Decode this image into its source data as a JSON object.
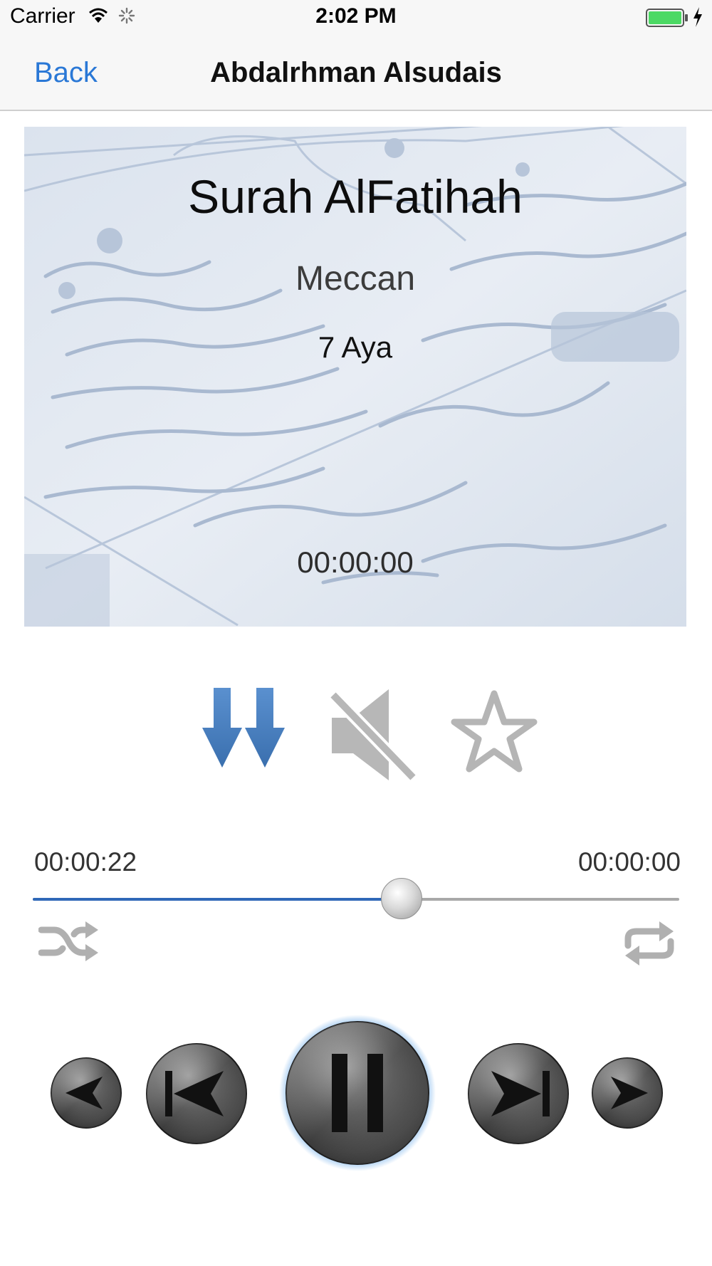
{
  "status_bar": {
    "carrier": "Carrier",
    "time": "2:02 PM"
  },
  "nav": {
    "back_label": "Back",
    "title": "Abdalrhman Alsudais"
  },
  "artwork": {
    "surah": "Surah AlFatihah",
    "type": "Meccan",
    "ayat": "7 Aya",
    "duration": "00:00:00"
  },
  "actions": {
    "download_icon": "double-down-arrow-icon",
    "mute_icon": "speaker-muted-icon",
    "favorite_icon": "star-outline-icon"
  },
  "progress": {
    "elapsed": "00:00:22",
    "remaining": "00:00:00",
    "position_fraction": 0.57
  },
  "modes": {
    "shuffle_icon": "shuffle-icon",
    "repeat_icon": "repeat-icon"
  },
  "transport": {
    "previous_icon": "small-back-arrow-icon",
    "skip_back_icon": "skip-back-icon",
    "pause_icon": "pause-icon",
    "skip_forward_icon": "skip-forward-icon",
    "next_icon": "small-forward-arrow-icon"
  },
  "colors": {
    "accent": "#2a78d6",
    "progress_fill": "#2f68b8",
    "download_blue": "#4a80c0",
    "icon_gray": "#b3b3b3"
  }
}
